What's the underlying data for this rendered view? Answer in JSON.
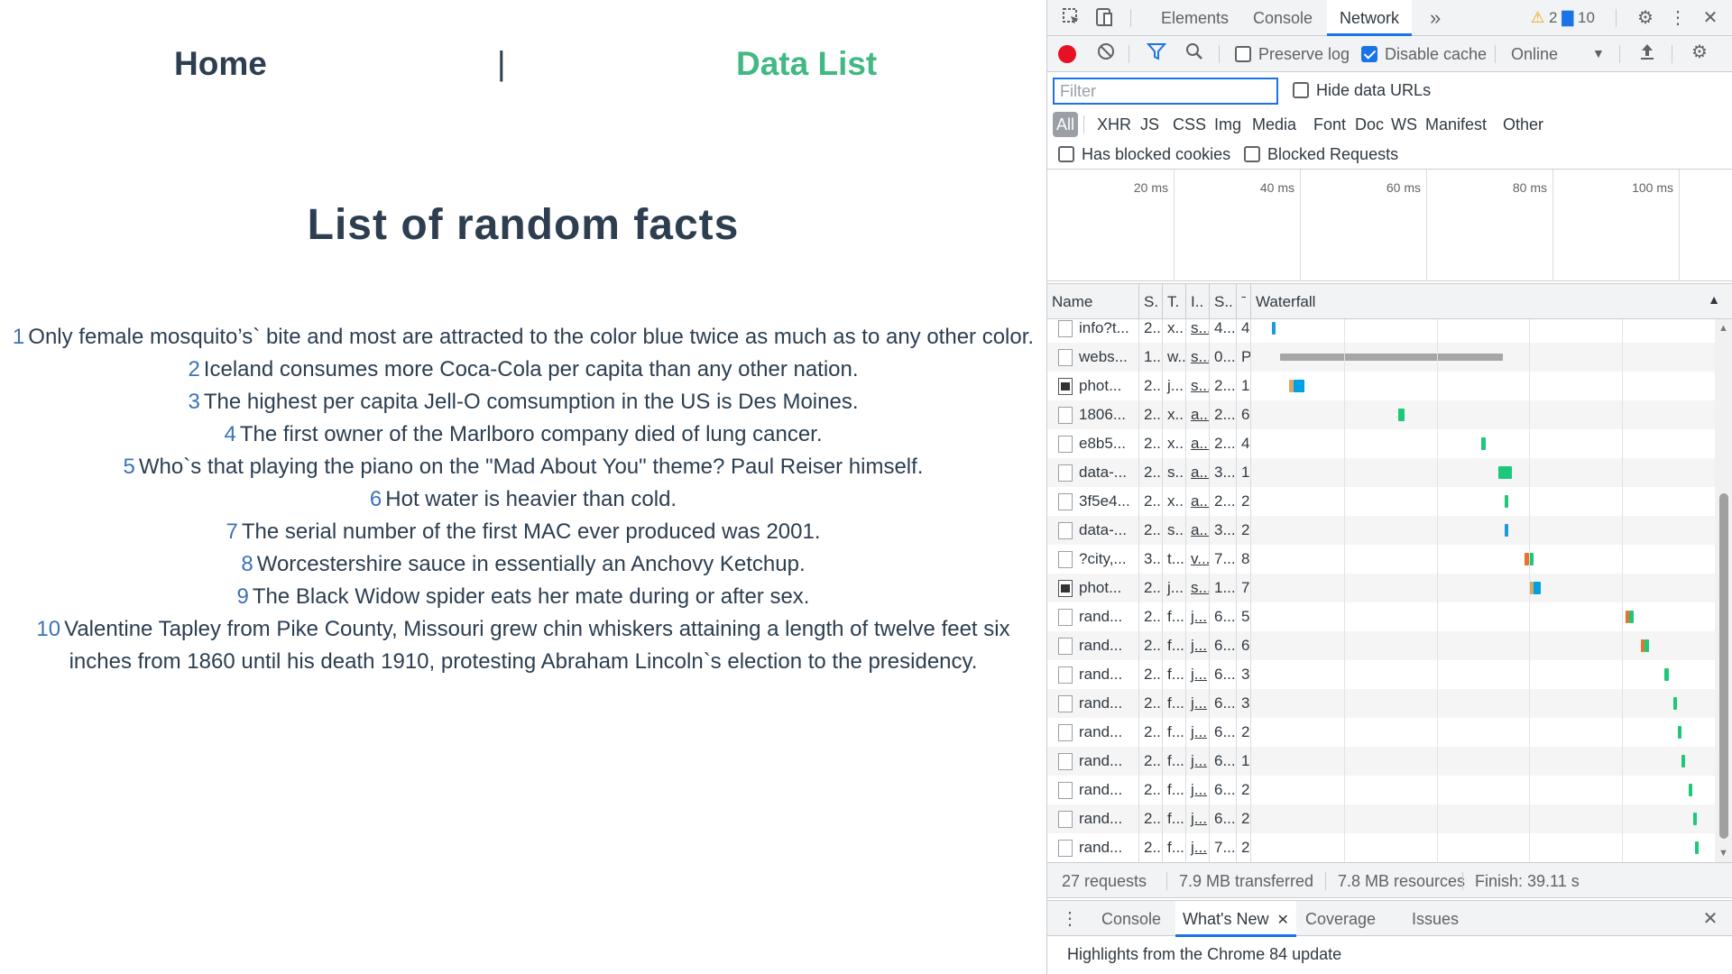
{
  "page": {
    "nav": {
      "home": "Home",
      "separator": "|",
      "data_list": "Data List"
    },
    "title": "List of random facts",
    "facts": [
      {
        "n": "1",
        "text": "Only female mosquito’s` bite and most are attracted to the color blue twice as much as to any other color."
      },
      {
        "n": "2",
        "text": "Iceland consumes more Coca-Cola per capita than any other nation."
      },
      {
        "n": "3",
        "text": "The highest per capita Jell-O comsumption in the US is Des Moines."
      },
      {
        "n": "4",
        "text": "The first owner of the Marlboro company died of lung cancer."
      },
      {
        "n": "5",
        "text": "Who`s that playing the piano on the \"Mad About You\" theme? Paul Reiser himself."
      },
      {
        "n": "6",
        "text": "Hot water is heavier than cold."
      },
      {
        "n": "7",
        "text": "The serial number of the first MAC ever produced was 2001."
      },
      {
        "n": "8",
        "text": "Worcestershire sauce in essentially an Anchovy Ketchup."
      },
      {
        "n": "9",
        "text": "The Black Widow spider eats her mate during or after sex."
      },
      {
        "n": "10",
        "text": "Valentine Tapley from Pike County, Missouri  grew chin whiskers attaining a length of twelve feet six inches from 1860 until his death 1910, protesting Abraham Lincoln`s election to the presidency."
      }
    ],
    "colors": {
      "text": "#2c3e50",
      "active_link": "#42b983",
      "number": "#3a73b8"
    }
  },
  "devtools": {
    "tabs": [
      "Elements",
      "Console",
      "Network"
    ],
    "active_tab": "Network",
    "more_tabs_glyph": "»",
    "warnings": "2",
    "messages": "10",
    "toolbar": {
      "preserve_log": {
        "label": "Preserve log",
        "checked": false
      },
      "disable_cache": {
        "label": "Disable cache",
        "checked": true
      },
      "throttling": "Online"
    },
    "filter": {
      "placeholder": "Filter",
      "value": "",
      "hide_data_urls": "Hide data URLs"
    },
    "types": [
      "All",
      "XHR",
      "JS",
      "CSS",
      "Img",
      "Media",
      "Font",
      "Doc",
      "WS",
      "Manifest",
      "Other"
    ],
    "blocked": {
      "has_blocked_cookies": "Has blocked cookies",
      "blocked_requests": "Blocked Requests"
    },
    "overview_ticks": [
      "20 ms",
      "40 ms",
      "60 ms",
      "80 ms",
      "100 ms"
    ],
    "columns": [
      "Name",
      "S.",
      "T.",
      "I..",
      "S..",
      "ˉ",
      "Waterfall"
    ],
    "rows": [
      {
        "name": "info?t...",
        "status": "2...",
        "type": "x..",
        "init": "s...",
        "size": "4...",
        "time": "4",
        "u": true,
        "icon": "doc",
        "bars": [
          {
            "s": 0.03,
            "e": 0.035,
            "c": "#1a9be0"
          }
        ]
      },
      {
        "name": "webs...",
        "status": "1...",
        "type": "w..",
        "init": "s...",
        "size": "0...",
        "time": "P",
        "u": true,
        "icon": "doc",
        "bars": [
          {
            "s": 0.05,
            "e": 0.56,
            "c": "#a6a6a6"
          }
        ]
      },
      {
        "name": "phot...",
        "status": "2...",
        "type": "j...",
        "init": "s...",
        "size": "2...",
        "time": "1",
        "u": true,
        "icon": "img",
        "bars": [
          {
            "s": 0.07,
            "e": 0.08,
            "c": "#d9a86b"
          },
          {
            "s": 0.08,
            "e": 0.105,
            "c": "#00a0e3"
          }
        ]
      },
      {
        "name": "1806...",
        "status": "2...",
        "type": "x..",
        "init": "a...",
        "size": "2...",
        "time": "6",
        "u": true,
        "icon": "doc",
        "bars": [
          {
            "s": 0.32,
            "e": 0.335,
            "c": "#1fc77a"
          }
        ]
      },
      {
        "name": "e8b5...",
        "status": "2...",
        "type": "x..",
        "init": "a...",
        "size": "2...",
        "time": "4",
        "u": true,
        "icon": "doc",
        "bars": [
          {
            "s": 0.51,
            "e": 0.52,
            "c": "#1fc77a"
          }
        ]
      },
      {
        "name": "data-...",
        "status": "2...",
        "type": "s..",
        "init": "a...",
        "size": "3...",
        "time": "1",
        "u": true,
        "icon": "doc",
        "bars": [
          {
            "s": 0.55,
            "e": 0.58,
            "c": "#1fc77a"
          }
        ]
      },
      {
        "name": "3f5e4...",
        "status": "2...",
        "type": "x..",
        "init": "a...",
        "size": "2...",
        "time": "2",
        "u": true,
        "icon": "doc",
        "bars": [
          {
            "s": 0.564,
            "e": 0.57,
            "c": "#1fc77a"
          }
        ]
      },
      {
        "name": "data-...",
        "status": "2...",
        "type": "s..",
        "init": "a...",
        "size": "3...",
        "time": "2",
        "u": true,
        "icon": "doc",
        "bars": [
          {
            "s": 0.564,
            "e": 0.568,
            "c": "#1a9be0"
          }
        ]
      },
      {
        "name": "?city,...",
        "status": "3...",
        "type": "t...",
        "init": "v...",
        "size": "7...",
        "time": "8",
        "u": true,
        "icon": "doc",
        "bars": [
          {
            "s": 0.61,
            "e": 0.62,
            "c": "#e8732c"
          },
          {
            "s": 0.62,
            "e": 0.63,
            "c": "#1fc77a"
          }
        ]
      },
      {
        "name": "phot...",
        "status": "2...",
        "type": "j...",
        "init": "s...",
        "size": "1...",
        "time": "7",
        "u": true,
        "icon": "img",
        "bars": [
          {
            "s": 0.62,
            "e": 0.63,
            "c": "#d9a86b"
          },
          {
            "s": 0.63,
            "e": 0.647,
            "c": "#00a0e3"
          }
        ]
      },
      {
        "name": "rand...",
        "status": "2...",
        "type": "f...",
        "init": "j...",
        "size": "6...",
        "time": "5",
        "u": true,
        "icon": "doc",
        "bars": [
          {
            "s": 0.84,
            "e": 0.85,
            "c": "#e8732c"
          },
          {
            "s": 0.85,
            "e": 0.86,
            "c": "#1fc77a"
          }
        ]
      },
      {
        "name": "rand...",
        "status": "2...",
        "type": "f...",
        "init": "j...",
        "size": "6...",
        "time": "6",
        "u": true,
        "icon": "doc",
        "bars": [
          {
            "s": 0.875,
            "e": 0.885,
            "c": "#e8732c"
          },
          {
            "s": 0.885,
            "e": 0.895,
            "c": "#1fc77a"
          }
        ]
      },
      {
        "name": "rand...",
        "status": "2...",
        "type": "f...",
        "init": "j...",
        "size": "6...",
        "time": "3",
        "u": true,
        "icon": "doc",
        "bars": [
          {
            "s": 0.93,
            "e": 0.94,
            "c": "#1fc77a"
          }
        ]
      },
      {
        "name": "rand...",
        "status": "2...",
        "type": "f...",
        "init": "j...",
        "size": "6...",
        "time": "3",
        "u": true,
        "icon": "doc",
        "bars": [
          {
            "s": 0.95,
            "e": 0.957,
            "c": "#1fc77a"
          }
        ]
      },
      {
        "name": "rand...",
        "status": "2...",
        "type": "f...",
        "init": "j...",
        "size": "6...",
        "time": "2",
        "u": true,
        "icon": "doc",
        "bars": [
          {
            "s": 0.96,
            "e": 0.967,
            "c": "#1fc77a"
          }
        ]
      },
      {
        "name": "rand...",
        "status": "2...",
        "type": "f...",
        "init": "j...",
        "size": "6...",
        "time": "1",
        "u": true,
        "icon": "doc",
        "bars": [
          {
            "s": 0.97,
            "e": 0.977,
            "c": "#1fc77a"
          }
        ]
      },
      {
        "name": "rand...",
        "status": "2...",
        "type": "f...",
        "init": "j...",
        "size": "6...",
        "time": "2",
        "u": true,
        "icon": "doc",
        "bars": [
          {
            "s": 0.985,
            "e": 0.992,
            "c": "#1fc77a"
          }
        ]
      },
      {
        "name": "rand...",
        "status": "2...",
        "type": "f...",
        "init": "j...",
        "size": "6...",
        "time": "2",
        "u": true,
        "icon": "doc",
        "bars": [
          {
            "s": 0.995,
            "e": 1.0,
            "c": "#1fc77a"
          }
        ]
      },
      {
        "name": "rand...",
        "status": "2...",
        "type": "f...",
        "init": "j...",
        "size": "7...",
        "time": "2",
        "u": true,
        "icon": "doc",
        "bars": [
          {
            "s": 1.0,
            "e": 1.0,
            "c": "#1fc77a"
          }
        ]
      }
    ],
    "status": {
      "requests": "27 requests",
      "transferred": "7.9 MB transferred",
      "resources": "7.8 MB resources",
      "finish": "Finish: 39.11 s"
    },
    "drawer": {
      "tabs": [
        "Console",
        "What's New",
        "Coverage",
        "Issues"
      ],
      "active": "What's New",
      "highlights": "Highlights from the Chrome 84 update"
    },
    "colors": {
      "accent": "#1a73e8",
      "record": "#e81123",
      "warning": "#e8a200"
    }
  }
}
